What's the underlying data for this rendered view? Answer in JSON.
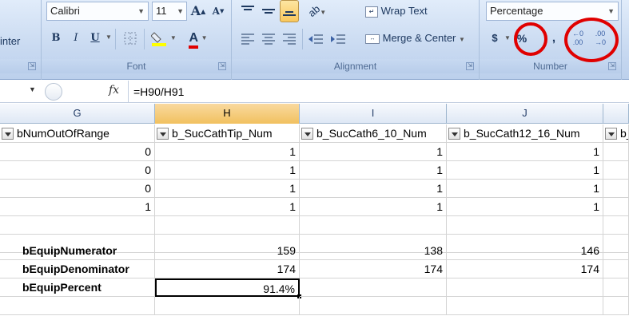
{
  "ribbon": {
    "clipboard": {
      "painter_partial": "inter",
      "launcher": "⇲"
    },
    "font": {
      "name": "Calibri",
      "size": "11",
      "grow": "A",
      "shrink": "A",
      "bold": "B",
      "italic": "I",
      "underline": "U",
      "label": "Font"
    },
    "alignment": {
      "wrap_text": "Wrap Text",
      "merge_center": "Merge & Center",
      "label": "Alignment"
    },
    "number": {
      "format": "Percentage",
      "currency": "$",
      "percent": "%",
      "comma": ",",
      "inc_decimal": "←0 .00",
      "dec_decimal": ".00 →0",
      "label": "Number"
    }
  },
  "formula_bar": {
    "fx": "fx",
    "formula": "=H90/H91"
  },
  "columns": [
    {
      "letter": "G",
      "header": "bNumOutOfRange"
    },
    {
      "letter": "H",
      "header": "b_SucCathTip_Num"
    },
    {
      "letter": "I",
      "header": "b_SucCath6_10_Num"
    },
    {
      "letter": "J",
      "header": "b_SucCath12_16_Num"
    },
    {
      "letter": "",
      "header": "b_C"
    }
  ],
  "data_rows": [
    [
      "0",
      "1",
      "1",
      "1"
    ],
    [
      "0",
      "1",
      "1",
      "1"
    ],
    [
      "0",
      "1",
      "1",
      "1"
    ],
    [
      "1",
      "1",
      "1",
      "1"
    ]
  ],
  "summary": {
    "numerator": {
      "label": "bEquipNumerator",
      "h": "159",
      "i": "138",
      "j": "146"
    },
    "denominator": {
      "label": "bEquipDenominator",
      "h": "174",
      "i": "174",
      "j": "174"
    },
    "percent": {
      "label": "bEquipPercent",
      "h": "91.4%"
    }
  },
  "colors": {
    "annotation": "#e00000",
    "selected_header": "#f1c15f",
    "ribbon": "#c9daf1",
    "fill_swatch": "#ffff00",
    "font_swatch": "#e00000"
  }
}
